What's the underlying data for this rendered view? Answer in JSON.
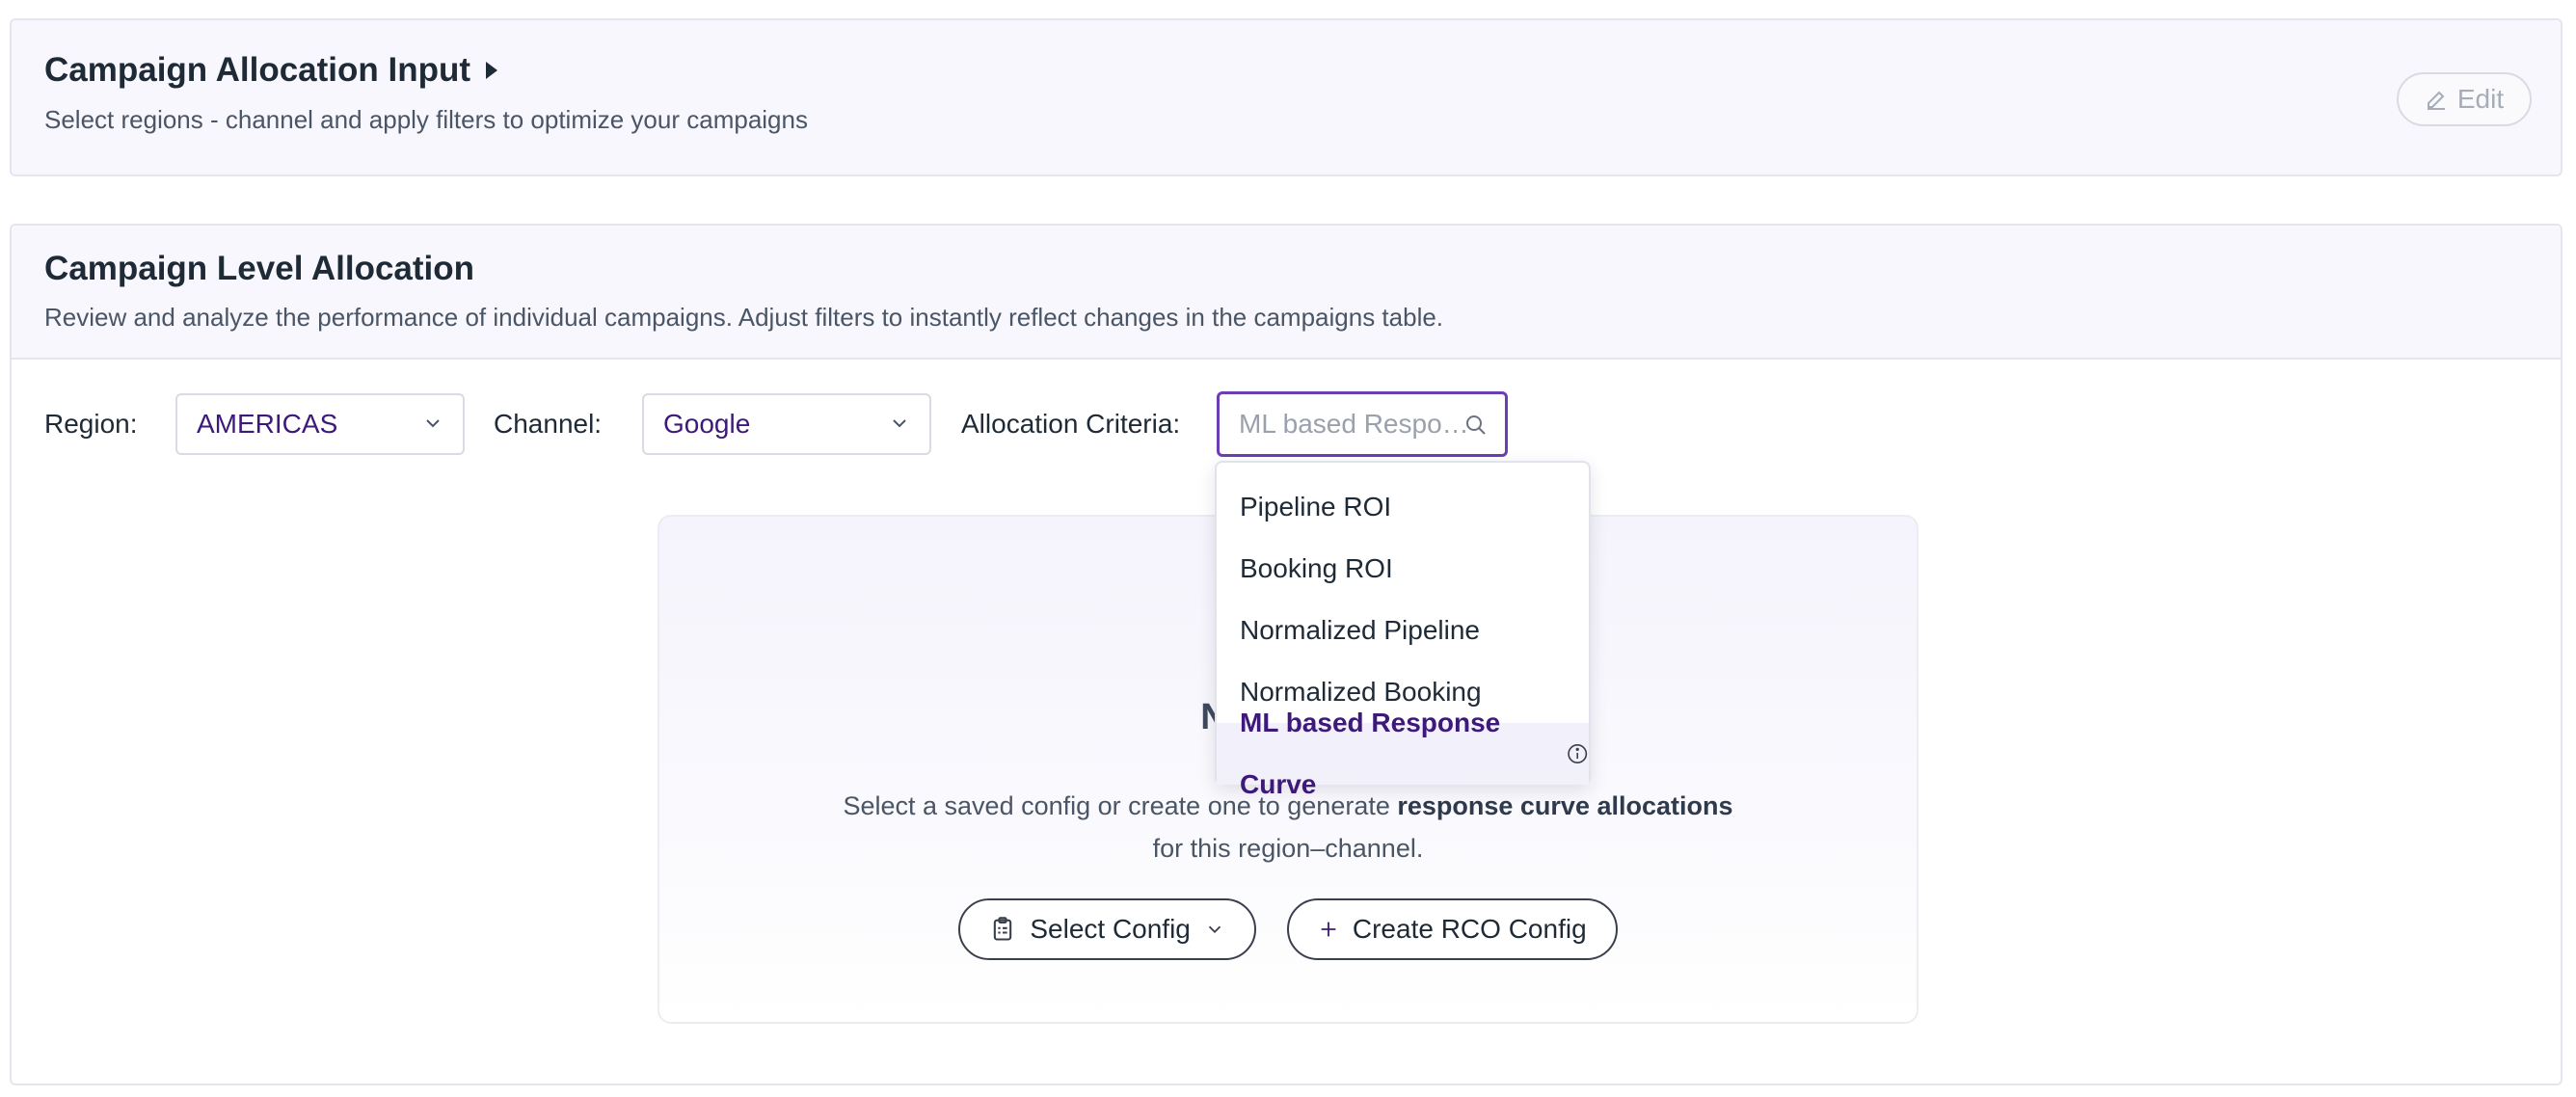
{
  "input_panel": {
    "title": "Campaign Allocation Input",
    "subtitle": "Select regions - channel and apply filters to optimize your campaigns",
    "edit_label": "Edit"
  },
  "allocation": {
    "title": "Campaign Level Allocation",
    "subtitle": "Review and analyze the performance of individual campaigns. Adjust filters to instantly reflect changes in the campaigns table.",
    "filters": {
      "region_label": "Region:",
      "region_value": "AMERICAS",
      "channel_label": "Channel:",
      "channel_value": "Google",
      "criteria_label": "Allocation Criteria:",
      "criteria_value": "ML based Respo…"
    },
    "criteria_options": [
      {
        "label": "Pipeline ROI"
      },
      {
        "label": "Booking ROI"
      },
      {
        "label": "Normalized Pipeline"
      },
      {
        "label": "Normalized Booking"
      },
      {
        "label": "ML based Response Curve",
        "selected": true
      }
    ],
    "empty_state": {
      "title": "No campa",
      "desc_prefix": "Select a saved config or create one to generate ",
      "desc_bold": "response curve allocations",
      "desc_line2": "for this region–channel.",
      "select_config_label": "Select Config",
      "create_config_label": "Create RCO Config"
    }
  },
  "colors": {
    "accent": "#3d1a7a",
    "focus_border": "#6a3fb5",
    "panel_bg": "#f7f7fd"
  }
}
